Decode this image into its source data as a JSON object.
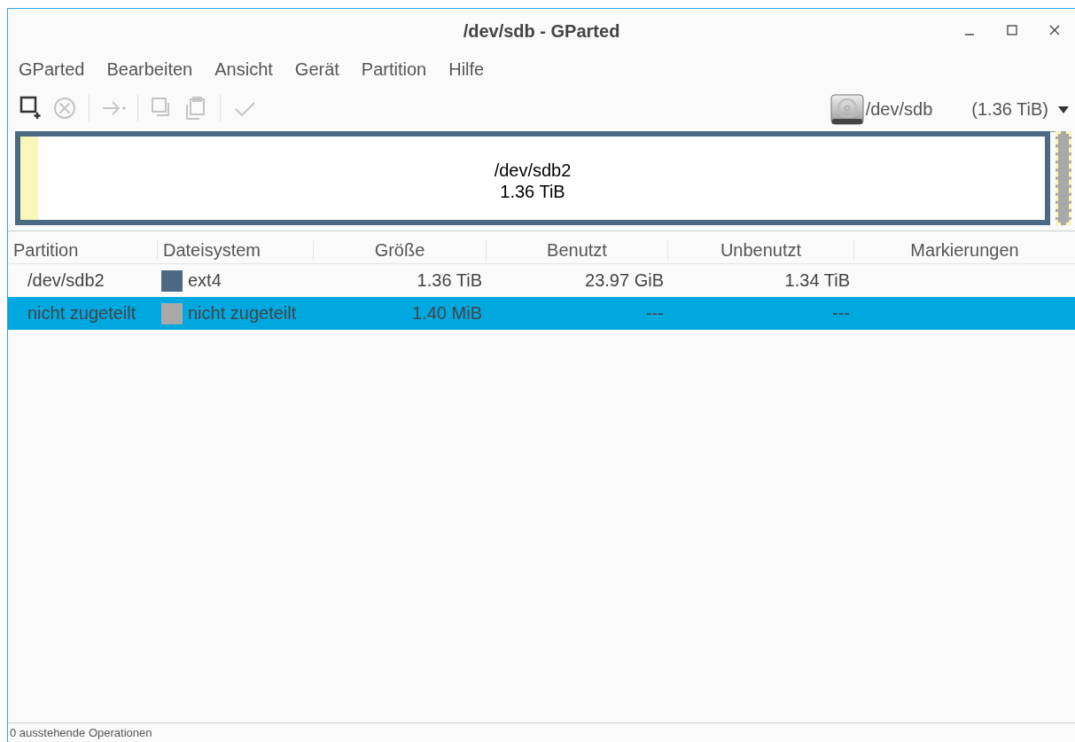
{
  "window": {
    "title": "/dev/sdb - GParted"
  },
  "menu": [
    "GParted",
    "Bearbeiten",
    "Ansicht",
    "Gerät",
    "Partition",
    "Hilfe"
  ],
  "toolbar": [
    {
      "kind": "new",
      "disabled": false
    },
    {
      "kind": "delete",
      "disabled": true
    },
    {
      "kind": "separator"
    },
    {
      "kind": "resize",
      "disabled": true
    },
    {
      "kind": "separator"
    },
    {
      "kind": "copy",
      "disabled": true
    },
    {
      "kind": "paste",
      "disabled": true
    },
    {
      "kind": "separator"
    },
    {
      "kind": "apply",
      "disabled": true
    }
  ],
  "device": {
    "name": "/dev/sdb",
    "size": "(1.36 TiB)"
  },
  "disk_map": [
    {
      "kind": "partition",
      "name": "/dev/sdb2",
      "size": "1.36 TiB",
      "color": "#4b6983",
      "level": 0.017
    },
    {
      "kind": "unallocated",
      "color": "#a9a9a9"
    }
  ],
  "table": {
    "columns": [
      "Partition",
      "Dateisystem",
      "Größe",
      "Benutzt",
      "Unbenutzt",
      "Markierungen"
    ],
    "rows": [
      {
        "partition": "/dev/sdb2",
        "filesystem": "ext4",
        "color": "#4b6983",
        "size": "1.36 TiB",
        "used": "23.97 GiB",
        "unused": "1.34 TiB",
        "selected": false
      },
      {
        "partition": "nicht zugeteilt",
        "filesystem": "nicht zugeteilt",
        "color": "#a9a9a9",
        "size": "1.40 MiB",
        "used": "---",
        "unused": "---",
        "selected": true
      }
    ]
  },
  "status_bar": "0 ausstehende Operationen"
}
